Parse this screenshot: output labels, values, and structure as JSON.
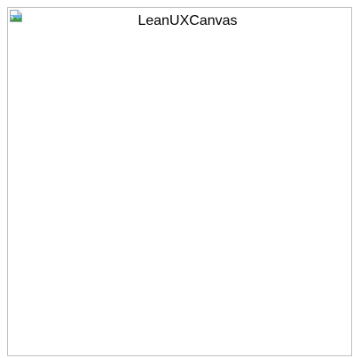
{
  "image": {
    "alt_text": "LeanUXCanvas",
    "icon": "broken-image-icon",
    "state": "broken"
  },
  "colors": {
    "frame_border": "#c0c0c0",
    "icon_paper": "#f4f6f8",
    "icon_blue": "#3a84d6",
    "icon_green": "#3d9a3d"
  }
}
